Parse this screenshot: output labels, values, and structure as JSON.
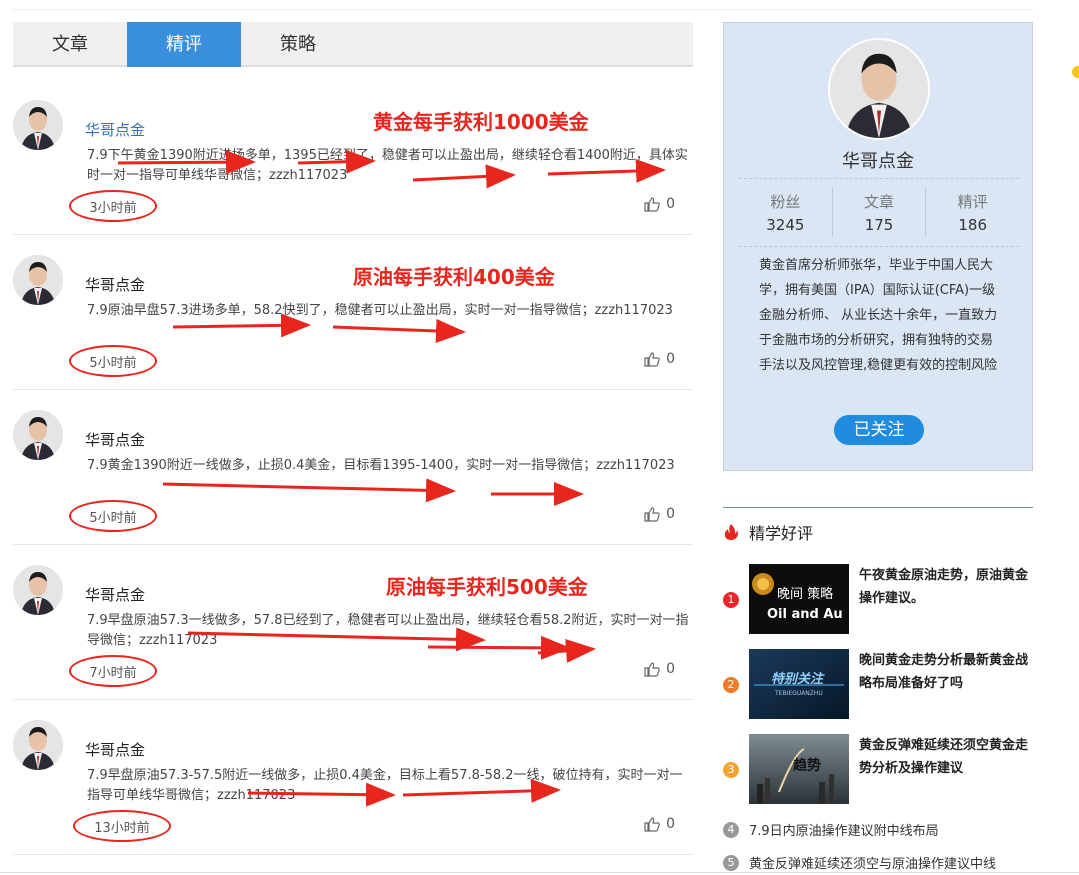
{
  "tabs": [
    {
      "label": "文章",
      "active": false
    },
    {
      "label": "精评",
      "active": true
    },
    {
      "label": "策略",
      "active": false
    }
  ],
  "posts": [
    {
      "author": "华哥点金",
      "content": "7.9下午黄金1390附近进场多单，1395已经到了，稳健者可以止盈出局，继续轻仓看1400附近，具体实时一对一指导可单线华哥微信；zzzh117023",
      "time": "3小时前",
      "likes": "0",
      "annotation": "黄金每手获利1000美金"
    },
    {
      "author": "华哥点金",
      "content": "7.9原油早盘57.3进场多单，58.2快到了，稳健者可以止盈出局，实时一对一指导微信；zzzh117023",
      "time": "5小时前",
      "likes": "0",
      "annotation": "原油每手获利400美金"
    },
    {
      "author": "华哥点金",
      "content": "7.9黄金1390附近一线做多，止损0.4美金，目标看1395-1400，实时一对一指导微信；zzzh117023",
      "time": "5小时前",
      "likes": "0",
      "annotation": ""
    },
    {
      "author": "华哥点金",
      "content": "7.9早盘原油57.3一线做多，57.8已经到了，稳健者可以止盈出局，继续轻仓看58.2附近，实时一对一指导微信；zzzh117023",
      "time": "7小时前",
      "likes": "0",
      "annotation": "原油每手获利500美金"
    },
    {
      "author": "华哥点金",
      "content": "7.9早盘原油57.3-57.5附近一线做多，止损0.4美金，目标上看57.8-58.2一线，破位持有，实时一对一指导可单线华哥微信；zzzh117023",
      "time": "13小时前",
      "likes": "0",
      "annotation": ""
    }
  ],
  "profile": {
    "name": "华哥点金",
    "stats": [
      {
        "label": "粉丝",
        "value": "3245"
      },
      {
        "label": "文章",
        "value": "175"
      },
      {
        "label": "精评",
        "value": "186"
      }
    ],
    "bio": "黄金首席分析师张华，毕业于中国人民大学，拥有美国（IPA）国际认证(CFA)一级金融分析师、 从业长达十余年，一直致力于金融市场的分析研究，拥有独特的交易手法以及风控管理,稳健更有效的控制风险",
    "follow_label": "已关注"
  },
  "recommend": {
    "title": "精学好评",
    "featured": [
      {
        "rank": "1",
        "rank_color": "#e8262d",
        "title": "午夜黄金原油走势，原油黄金操作建议。",
        "thumb_text": "晚间 策略",
        "thumb_sub": "Oil and Au"
      },
      {
        "rank": "2",
        "rank_color": "#f07c2a",
        "title": "晚间黄金走势分析最新黄金战略布局准备好了吗",
        "thumb_text": "特别关注",
        "thumb_sub": "TEBIEGUANZHU"
      },
      {
        "rank": "3",
        "rank_color": "#f4a42d",
        "title": "黄金反弹难延续还须空黄金走势分析及操作建议",
        "thumb_text": "趋势",
        "thumb_sub": ""
      }
    ],
    "list": [
      {
        "rank": "4",
        "title": "7.9日内原油操作建议附中线布局"
      },
      {
        "rank": "5",
        "title": "黄金反弹难延续还须空与原油操作建议中线"
      }
    ]
  }
}
